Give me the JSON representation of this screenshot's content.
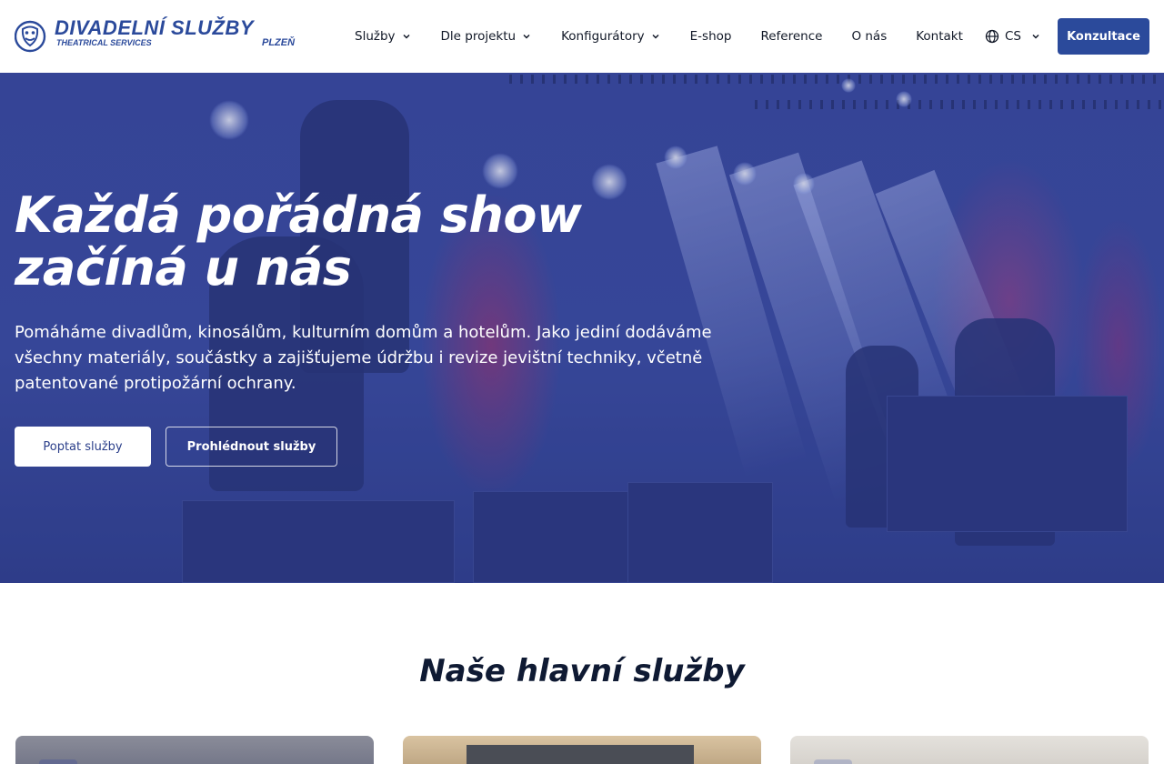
{
  "brand": {
    "name": "DIVADELNÍ SLUŽBY",
    "subtitle": "THEATRICAL SERVICES",
    "city": "PLZEŇ"
  },
  "nav": {
    "items": [
      {
        "label": "Služby",
        "dropdown": true
      },
      {
        "label": "Dle projektu",
        "dropdown": true
      },
      {
        "label": "Konfigurátory",
        "dropdown": true
      },
      {
        "label": "E-shop",
        "dropdown": false
      },
      {
        "label": "Reference",
        "dropdown": false
      },
      {
        "label": "O nás",
        "dropdown": false
      },
      {
        "label": "Kontakt",
        "dropdown": false
      }
    ],
    "language": "CS",
    "cta": "Konzultace"
  },
  "hero": {
    "title_line1": "Každá pořádná show",
    "title_line2": "začíná u nás",
    "text": "Pomáháme divadlům, kinosálům, kulturním domům a hotelům. Jako jediní dodáváme všechny materiály, součástky a zajišťujeme údržbu i revize jevištní techniky, včetně patentované protipožární ochrany.",
    "primary_button": "Poptat služby",
    "secondary_button": "Prohlédnout služby"
  },
  "services": {
    "title": "Naše hlavní služby"
  },
  "colors": {
    "brand_blue": "#2b4a9b",
    "hero_overlay": "#3a4a9c",
    "heading_dark": "#0f1a33"
  }
}
